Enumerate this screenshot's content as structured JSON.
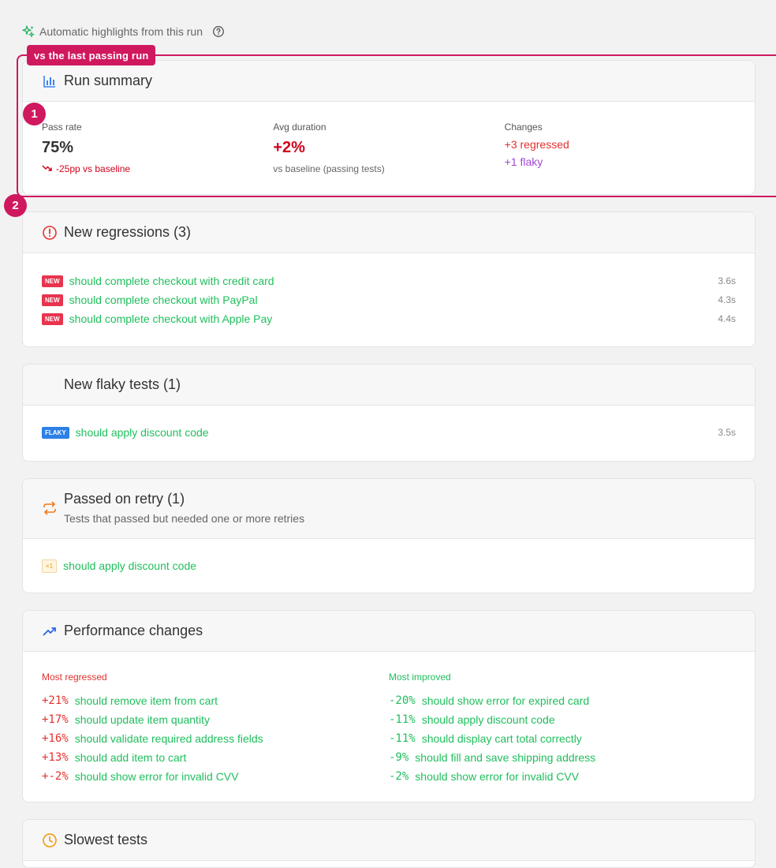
{
  "header": {
    "text": "Automatic highlights from this run",
    "sparkle_icon": "sparkle-icon",
    "help_icon": "help-circle-icon"
  },
  "annotation": {
    "label": "vs the last passing run",
    "markers": [
      "1",
      "2"
    ],
    "color": "#d0185f"
  },
  "run_summary": {
    "title": "Run summary",
    "pass_rate": {
      "label": "Pass rate",
      "value": "75%",
      "delta": "-25pp vs baseline"
    },
    "avg_duration": {
      "label": "Avg duration",
      "value": "+2%",
      "sub": "vs baseline (passing tests)"
    },
    "changes": {
      "label": "Changes",
      "regressed": "+3 regressed",
      "flaky": "+1 flaky"
    }
  },
  "new_regressions": {
    "title": "New regressions (3)",
    "items": [
      {
        "badge": "NEW",
        "name": "should complete checkout with credit card",
        "duration": "3.6s"
      },
      {
        "badge": "NEW",
        "name": "should complete checkout with PayPal",
        "duration": "4.3s"
      },
      {
        "badge": "NEW",
        "name": "should complete checkout with Apple Pay",
        "duration": "4.4s"
      }
    ]
  },
  "new_flaky": {
    "title": "New flaky tests (1)",
    "items": [
      {
        "badge": "FLAKY",
        "name": "should apply discount code",
        "duration": "3.5s"
      }
    ]
  },
  "passed_on_retry": {
    "title": "Passed on retry (1)",
    "subtitle": "Tests that passed but needed one or more retries",
    "items": [
      {
        "badge": "×1",
        "name": "should apply discount code"
      }
    ]
  },
  "performance": {
    "title": "Performance changes",
    "regressed_label": "Most regressed",
    "improved_label": "Most improved",
    "regressed": [
      {
        "pct": "+21%",
        "name": "should remove item from cart"
      },
      {
        "pct": "+17%",
        "name": "should update item quantity"
      },
      {
        "pct": "+16%",
        "name": "should validate required address fields"
      },
      {
        "pct": "+13%",
        "name": "should add item to cart"
      },
      {
        "pct": "+-2%",
        "name": "should show error for invalid CVV"
      }
    ],
    "improved": [
      {
        "pct": "-20%",
        "name": "should show error for expired card"
      },
      {
        "pct": "-11%",
        "name": "should apply discount code"
      },
      {
        "pct": "-11%",
        "name": "should display cart total correctly"
      },
      {
        "pct": "-9%",
        "name": "should fill and save shipping address"
      },
      {
        "pct": "-2%",
        "name": "should show error for invalid CVV"
      }
    ]
  },
  "slowest": {
    "title": "Slowest tests"
  }
}
